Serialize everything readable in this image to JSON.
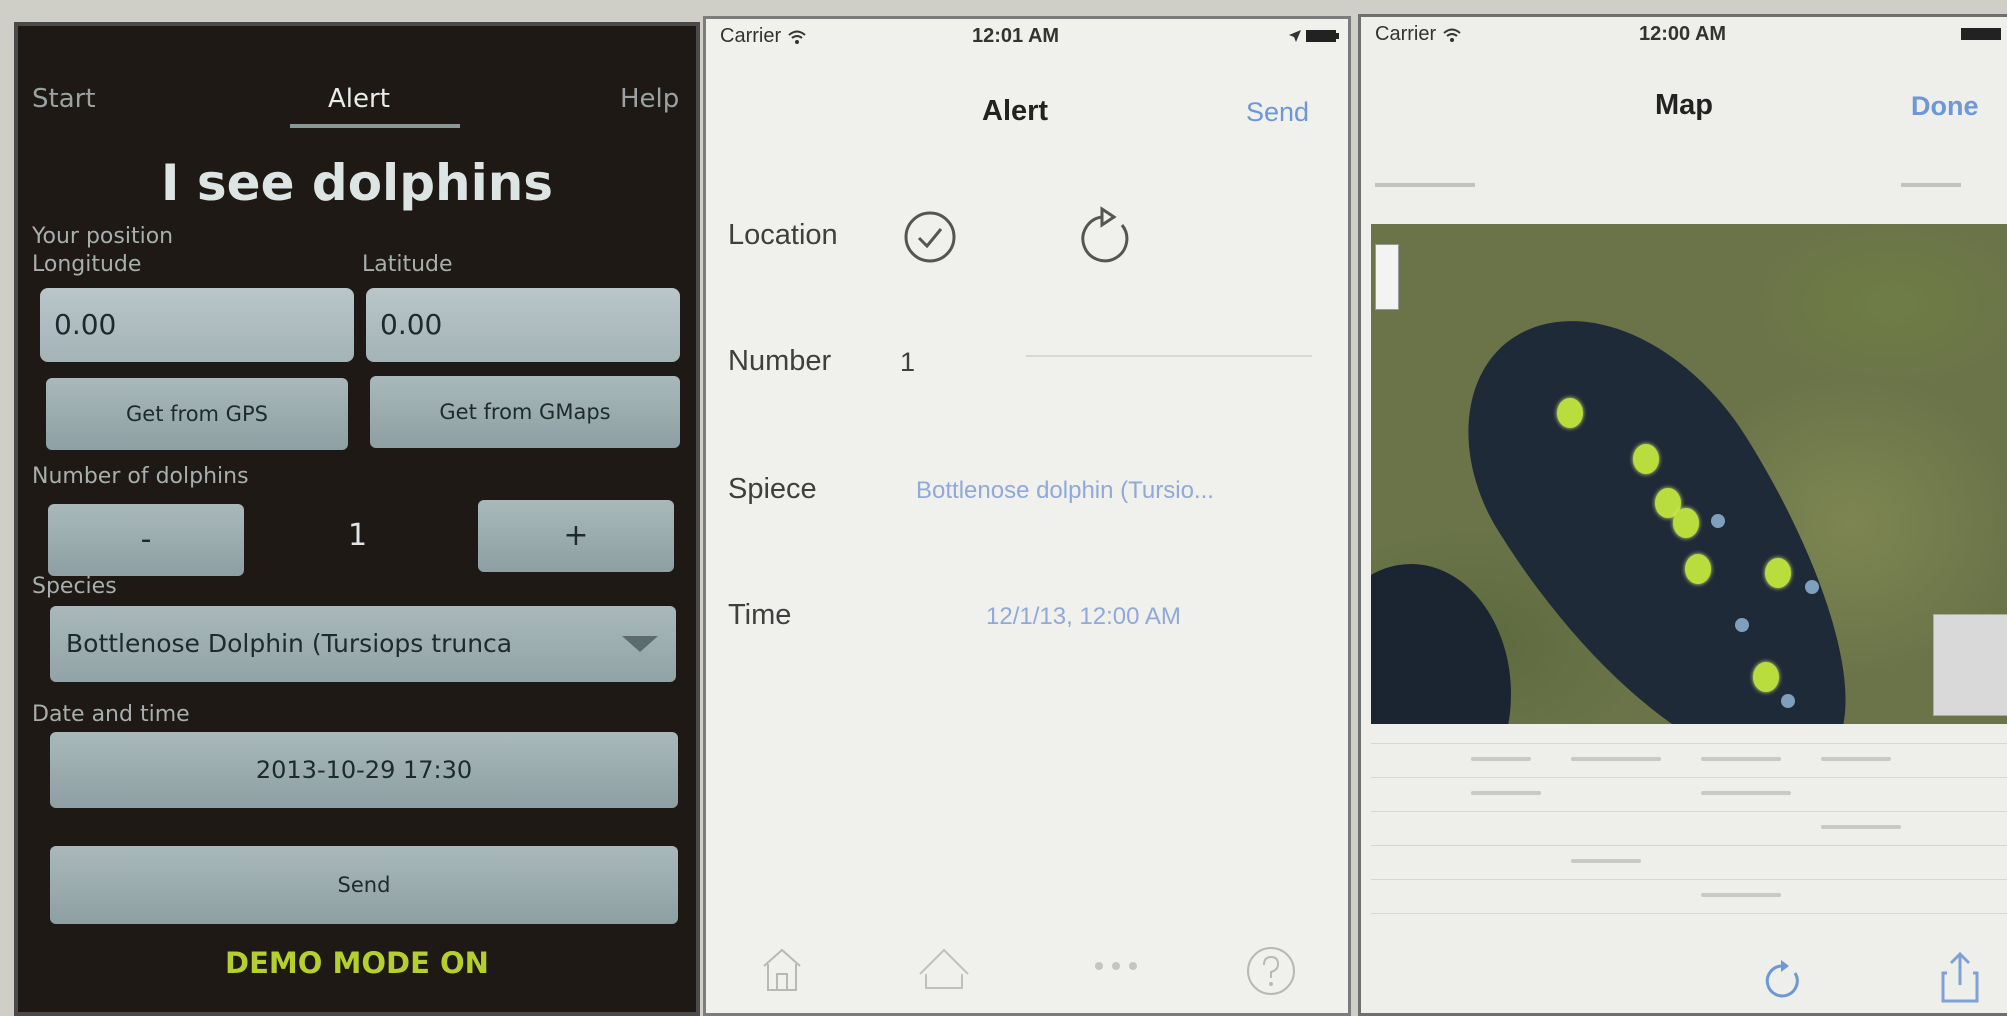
{
  "panel1": {
    "tabs": [
      "Start",
      "Alert",
      "Help"
    ],
    "title": "I see dolphins",
    "your_position_label": "Your position",
    "longitude_label": "Longitude",
    "latitude_label": "Latitude",
    "longitude_value": "0.00",
    "latitude_value": "0.00",
    "gps_button": "Get from GPS",
    "gmaps_button": "Get from GMaps",
    "number_label": "Number of dolphins",
    "minus_button": "-",
    "plus_button": "+",
    "count": "1",
    "species_label": "Species",
    "species_value": "Bottlenose Dolphin (Tursiops trunca",
    "datetime_label": "Date and time",
    "datetime_value": "2013-10-29 17:30",
    "send_button": "Send",
    "demo_mode": "DEMO MODE ON",
    "colors": {
      "background": "#1e1915",
      "accent": "#b5cf2c"
    }
  },
  "panel2": {
    "carrier": "Carrier",
    "time": "12:01 AM",
    "nav_title": "Alert",
    "nav_send": "Send",
    "location_label": "Location",
    "number_label": "Number",
    "number_value": "1",
    "species_label": "Spiece",
    "species_value": "Bottlenose dolphin (Tursio...",
    "time_label": "Time",
    "time_value": "12/1/13, 12:00 AM",
    "icons": [
      "checkmark-circle-icon",
      "refresh-icon",
      "home-icon",
      "boat-icon",
      "more-icon",
      "help-icon"
    ]
  },
  "panel3": {
    "carrier": "Carrier",
    "time": "12:00 AM",
    "nav_title": "Map",
    "nav_done": "Done",
    "icons": [
      "refresh-icon",
      "share-icon"
    ],
    "colors": {
      "marker": "#b9dd3d",
      "sea": "#1f2a38"
    }
  }
}
